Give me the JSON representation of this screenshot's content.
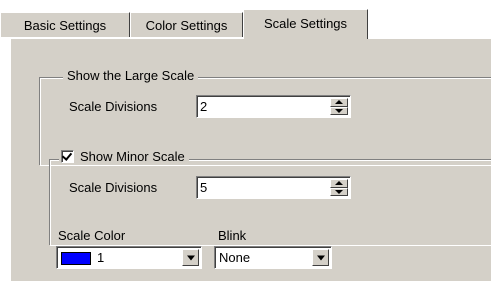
{
  "tabs": [
    {
      "label": "Basic Settings"
    },
    {
      "label": "Color Settings"
    },
    {
      "label": "Scale Settings"
    }
  ],
  "large_scale": {
    "legend": "Show the Large Scale",
    "divisions_label": "Scale Divisions",
    "divisions_value": "2"
  },
  "minor_scale": {
    "legend": "Show Minor Scale",
    "checked": true,
    "divisions_label": "Scale Divisions",
    "divisions_value": "5"
  },
  "scale_color": {
    "label": "Scale Color",
    "value": "1",
    "swatch_color": "#0000ff"
  },
  "blink": {
    "label": "Blink",
    "value": "None"
  }
}
